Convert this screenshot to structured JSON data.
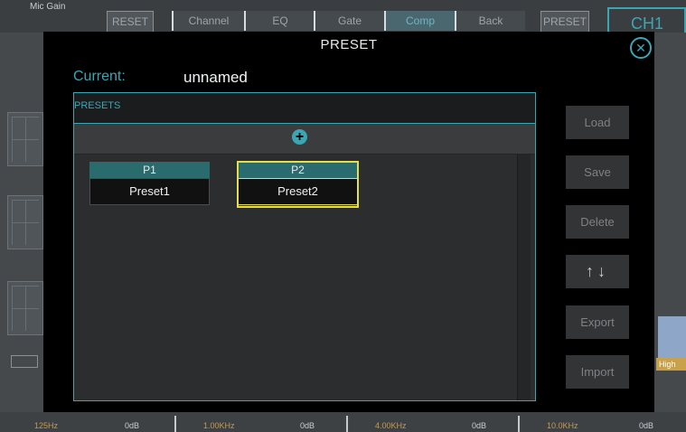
{
  "background": {
    "mic_gain_label": "Mic Gain",
    "tabs": [
      "RESET",
      "Channel",
      "EQ",
      "Gate",
      "Comp",
      "Back",
      "PRESET"
    ],
    "channel_label": "CH1",
    "high_badge": "High",
    "freq_footer": [
      "125Hz",
      "0dB",
      "1.00KHz",
      "0dB",
      "4.00KHz",
      "0dB",
      "10.0KHz",
      "0dB"
    ]
  },
  "modal": {
    "title": "PRESET",
    "close_icon": "close-icon",
    "current_label": "Current:",
    "current_value": "unnamed",
    "presets_header": "PRESETS",
    "add_icon": "plus-circle-icon",
    "presets": [
      {
        "id": "P1",
        "name": "Preset1",
        "selected": false
      },
      {
        "id": "P2",
        "name": "Preset2",
        "selected": true
      }
    ],
    "buttons": {
      "load": "Load",
      "save": "Save",
      "delete": "Delete",
      "reorder": "↑↓",
      "export": "Export",
      "import": "Import"
    }
  },
  "colors": {
    "accent": "#3aa6b4",
    "selected_outline": "#e6de4a",
    "preset_id_bg": "#2a6c6e"
  }
}
